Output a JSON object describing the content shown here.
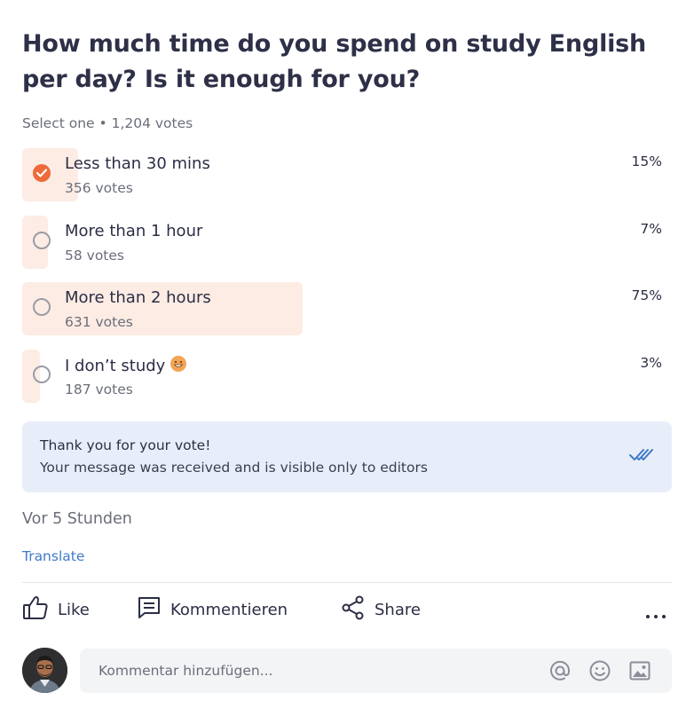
{
  "poll": {
    "question": "How much time do you spend on study English per day? Is it enough for you?",
    "meta": "Select one • 1,204 votes",
    "options": [
      {
        "label": "Less than 30 mins",
        "votes": "356 votes",
        "percent": "15%",
        "share": 15,
        "selected": true
      },
      {
        "label": "More than 1 hour",
        "votes": "58 votes",
        "percent": "7%",
        "share": 7,
        "selected": false
      },
      {
        "label": "More than 2 hours",
        "votes": "631 votes",
        "percent": "75%",
        "share": 75,
        "selected": false
      },
      {
        "label": "I don’t study",
        "votes": "187 votes",
        "percent": "3%",
        "share": 3,
        "selected": false,
        "emoji": "grinning-face-emoji"
      }
    ]
  },
  "notice": {
    "title": "Thank you for your vote!",
    "text": "Your message was received and is visible only to editors",
    "icon": "double-check-icon"
  },
  "timestamp": "Vor 5 Stunden",
  "translate_label": "Translate",
  "actions": {
    "like": "Like",
    "comment": "Kommentieren",
    "share": "Share"
  },
  "comment_input": {
    "placeholder": "Kommentar hinzufügen..."
  },
  "colors": {
    "accent": "#ee6a3a",
    "bar": "#fdece4",
    "notice_bg": "#e8eef9",
    "link": "#3f7ac9"
  }
}
